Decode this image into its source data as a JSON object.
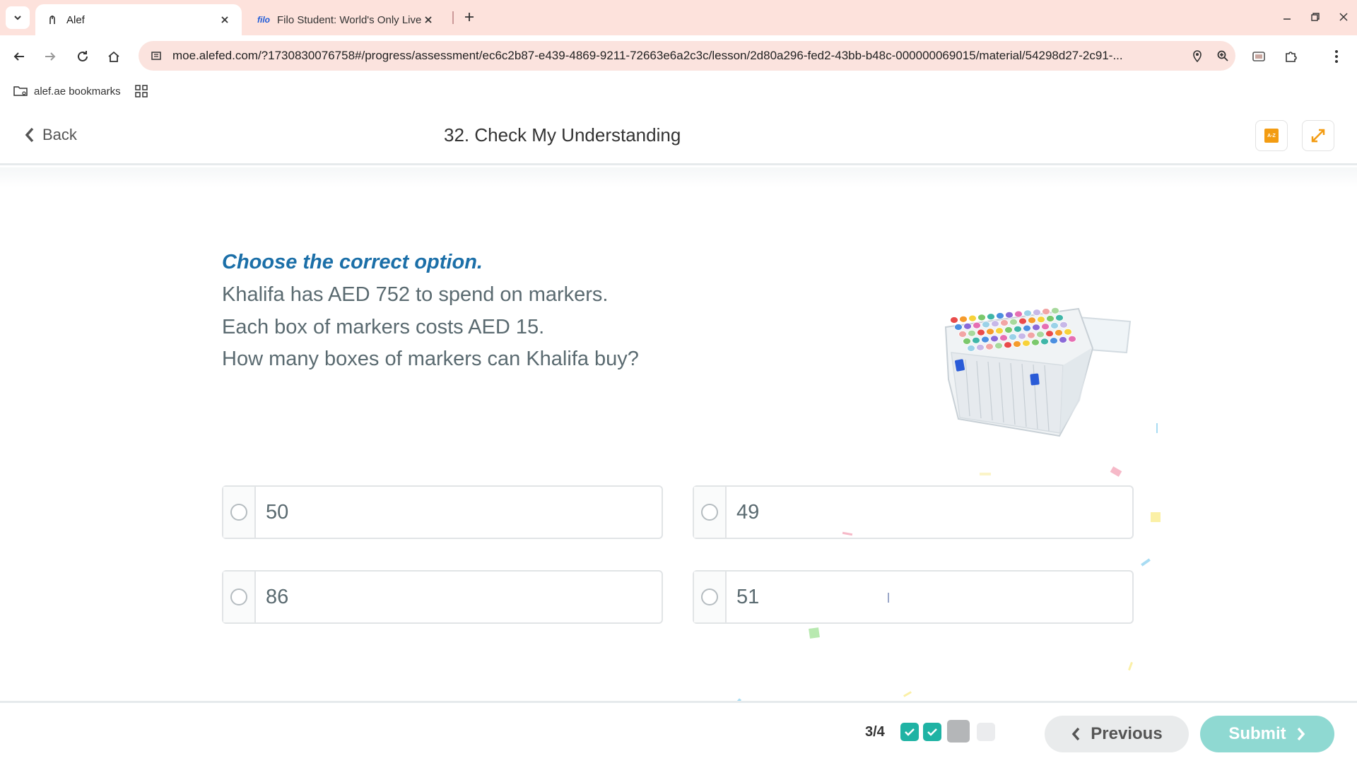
{
  "browser": {
    "tabs": [
      {
        "title": "Alef",
        "favicon": "alef-icon",
        "active": true
      },
      {
        "title": "Filo Student: World's Only Live I",
        "favicon_text": "filo",
        "active": false
      }
    ],
    "url": "moe.alefed.com/?1730830076758#/progress/assessment/ec6c2b87-e439-4869-9211-72663e6a2c3c/lesson/2d80a296-fed2-43bb-b48c-000000069015/material/54298d27-2c91-...",
    "bookmark_folder": "alef.ae bookmarks"
  },
  "header": {
    "back_label": "Back",
    "title": "32. Check My Understanding",
    "dictionary_icon_text": "A-Z"
  },
  "question": {
    "instruction": "Choose the correct option.",
    "lines": [
      "Khalifa has AED 752 to spend on markers.",
      "Each box of markers costs AED 15.",
      "How many boxes of markers can Khalifa buy?"
    ]
  },
  "options": [
    "50",
    "49",
    "86",
    "51"
  ],
  "footer": {
    "progress": "3/4",
    "steps": [
      "done",
      "done",
      "current",
      "pending"
    ],
    "previous_label": "Previous",
    "submit_label": "Submit"
  },
  "colors": {
    "chrome_bg": "#fde2dc",
    "instruction": "#1b6fa8",
    "step_done": "#1fb3a4",
    "submit_bg": "#8fd9d2",
    "accent_orange": "#f39c12"
  }
}
